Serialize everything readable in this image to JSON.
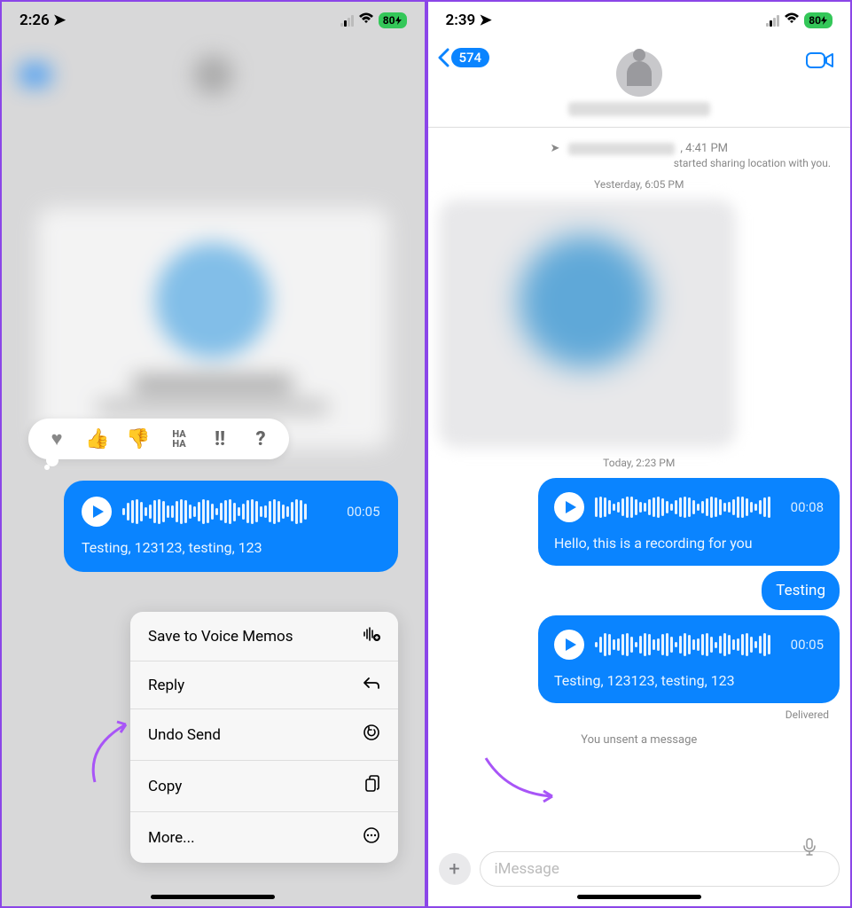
{
  "left": {
    "status_time": "2:26",
    "battery": "80",
    "voice": {
      "duration": "00:05",
      "transcript": "Testing, 123123, testing, 123"
    },
    "tapbacks": {
      "heart": "♥",
      "thumbs_up": "👍",
      "thumbs_down": "👎",
      "haha": "HA HA",
      "exclaim": "‼",
      "question": "?"
    },
    "menu": {
      "save": "Save to Voice Memos",
      "reply": "Reply",
      "undo": "Undo Send",
      "copy": "Copy",
      "more": "More..."
    }
  },
  "right": {
    "status_time": "2:39",
    "battery": "80",
    "back_count": "574",
    "top_time": ", 4:41 PM",
    "location_shared": "started sharing location with you.",
    "ts_yesterday": "Yesterday, 6:05 PM",
    "ts_today": "Today, 2:23 PM",
    "voice1": {
      "duration": "00:08",
      "transcript": "Hello, this is a recording for you"
    },
    "text_msg": "Testing",
    "voice2": {
      "duration": "00:05",
      "transcript": "Testing, 123123, testing, 123"
    },
    "delivered": "Delivered",
    "unsent": "You unsent a message",
    "input_placeholder": "iMessage"
  }
}
